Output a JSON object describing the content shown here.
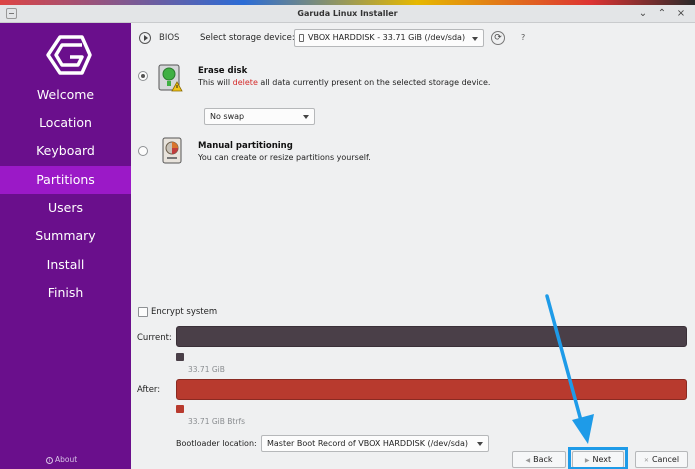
{
  "window": {
    "title": "Garuda Linux Installer"
  },
  "sidebar": {
    "items": [
      {
        "label": "Welcome"
      },
      {
        "label": "Location"
      },
      {
        "label": "Keyboard"
      },
      {
        "label": "Partitions",
        "active": true
      },
      {
        "label": "Users"
      },
      {
        "label": "Summary"
      },
      {
        "label": "Install"
      },
      {
        "label": "Finish"
      }
    ],
    "about_label": "About"
  },
  "toolbar": {
    "firmware": "BIOS",
    "device_label": "Select storage device:",
    "device_value": "VBOX HARDDISK - 33.71 GiB (/dev/sda)",
    "help": "?"
  },
  "options": {
    "erase": {
      "title": "Erase disk",
      "desc_before": "This will ",
      "desc_highlight": "delete",
      "desc_after": " all data currently present on the selected storage device.",
      "selected": true
    },
    "swap_value": "No swap",
    "manual": {
      "title": "Manual partitioning",
      "desc": "You can create or resize partitions yourself.",
      "selected": false
    }
  },
  "encrypt": {
    "label": "Encrypt system",
    "checked": false
  },
  "partitions": {
    "current_label": "Current:",
    "current_size": "33.71 GiB",
    "current_color": "#4a3f48",
    "after_label": "After:",
    "after_size": "33.71 GiB  Btrfs",
    "after_color": "#b83a2e"
  },
  "bootloader": {
    "label": "Bootloader location:",
    "value": "Master Boot Record of VBOX HARDDISK (/dev/sda)"
  },
  "buttons": {
    "back": "Back",
    "next": "Next",
    "cancel": "Cancel"
  },
  "colors": {
    "sidebar": "#6a0f8c",
    "sidebar_active": "#9b19c7",
    "annotation": "#1e9be8"
  }
}
